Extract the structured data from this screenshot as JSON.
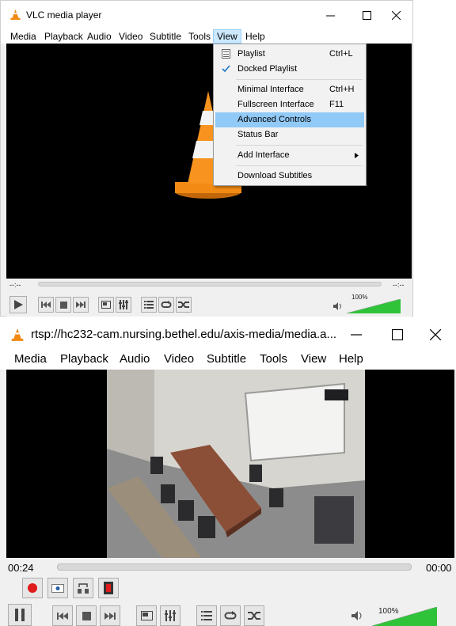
{
  "window1": {
    "title": "VLC media player",
    "menu": [
      "Media",
      "Playback",
      "Audio",
      "Video",
      "Subtitle",
      "Tools",
      "View",
      "Help"
    ],
    "view_menu": {
      "items": [
        {
          "label": "Playlist",
          "shortcut": "Ctrl+L",
          "icon": "playlist-icon"
        },
        {
          "label": "Docked Playlist",
          "shortcut": "",
          "icon": "checkmark-icon"
        },
        {
          "label": "Minimal Interface",
          "shortcut": "Ctrl+H"
        },
        {
          "label": "Fullscreen Interface",
          "shortcut": "F11"
        },
        {
          "label": "Advanced Controls",
          "shortcut": "",
          "highlighted": true
        },
        {
          "label": "Status Bar",
          "shortcut": ""
        },
        {
          "label": "Add Interface",
          "shortcut": "",
          "submenu": true
        },
        {
          "label": "Download Subtitles",
          "shortcut": ""
        }
      ]
    },
    "time_elapsed": "--:--",
    "time_total": "--:--",
    "volume": "100%",
    "volume_level": 1.0
  },
  "window2": {
    "title": "rtsp://hc232-cam.nursing.bethel.edu/axis-media/media.a...",
    "menu": [
      "Media",
      "Playback",
      "Audio",
      "Video",
      "Subtitle",
      "Tools",
      "View",
      "Help"
    ],
    "time_elapsed": "00:24",
    "time_total": "00:00",
    "volume": "100%",
    "volume_level": 1.0
  },
  "colors": {
    "vlc_orange": "#f28a14",
    "menu_highlight": "#91c9f7",
    "volume_green": "#2fc33a",
    "record_red": "#e01b1b"
  }
}
